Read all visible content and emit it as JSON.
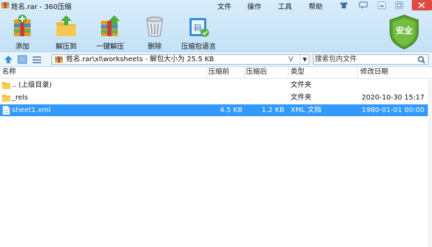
{
  "window": {
    "title": "姓名.rar - 360压缩",
    "menus": [
      "文件",
      "操作",
      "工具",
      "帮助"
    ]
  },
  "toolbar": {
    "items": [
      {
        "label": "添加",
        "icon": "add-archive-icon"
      },
      {
        "label": "解压到",
        "icon": "extract-to-icon"
      },
      {
        "label": "一键解压",
        "icon": "one-click-extract-icon"
      },
      {
        "label": "删除",
        "icon": "trash-icon"
      },
      {
        "label": "压缩包语言",
        "icon": "archive-language-icon"
      }
    ],
    "security_label": "安全"
  },
  "address": {
    "path": "姓名.rar\\xl\\worksheets - 解包大小为 25.5 KB",
    "v_label": "V",
    "search_placeholder": "搜索包内文件"
  },
  "columns": {
    "name": "名称",
    "compressed": "压缩前",
    "packed": "压缩后",
    "type": "类型",
    "modified": "修改日期"
  },
  "files": [
    {
      "name": ".. (上级目录)",
      "compressed": "",
      "packed": "",
      "type": "文件夹",
      "modified": "",
      "icon": "folder-icon",
      "selected": false
    },
    {
      "name": "_rels",
      "compressed": "",
      "packed": "",
      "type": "文件夹",
      "modified": "2020-10-30 15:17",
      "icon": "folder-icon",
      "selected": false
    },
    {
      "name": "sheet1.xml",
      "compressed": "4.5 KB",
      "packed": "1.2 KB",
      "type": "XML 文档",
      "modified": "1980-01-01 00:00",
      "icon": "xml-file-icon",
      "selected": true
    }
  ],
  "colors": {
    "selection": "#3399ff",
    "toolbar_bg": "#c4e1f7",
    "close_button": "#e04b3f",
    "shield": "#5aa52d"
  }
}
